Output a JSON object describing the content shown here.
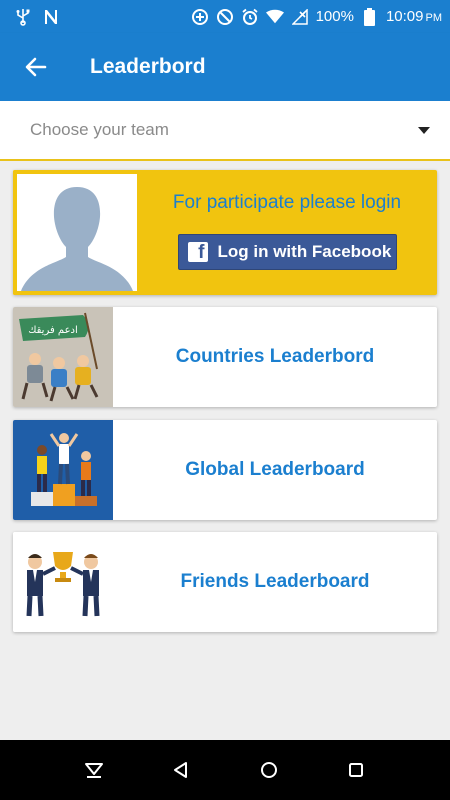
{
  "status_bar": {
    "battery_percent": "100%",
    "time": "10:09",
    "ampm": "PM",
    "icons": [
      "usb-icon",
      "n-notification-icon",
      "data-saver-icon",
      "do-not-disturb-icon",
      "alarm-icon",
      "wifi-icon",
      "no-signal-icon",
      "battery-icon"
    ]
  },
  "app_bar": {
    "title": "Leaderbord",
    "back_icon": "arrow-back-icon",
    "color": "#1b7fcf"
  },
  "team_select": {
    "placeholder": "Choose your team",
    "accent": "#e9c21a"
  },
  "login_card": {
    "prompt": "For participate please login",
    "facebook_button": "Log in with Facebook",
    "facebook_logo_letter": "f",
    "background": "#f1c40f"
  },
  "leaderboards": [
    {
      "label": "Countries Leaderbord",
      "banner_text": "ادعم فريقك",
      "thumbnail": "kids-with-flag-illustration"
    },
    {
      "label": "Global Leaderboard",
      "thumbnail": "podium-winners-illustration"
    },
    {
      "label": "Friends Leaderboard",
      "thumbnail": "businessmen-trophy-illustration"
    }
  ],
  "nav_bar": {
    "icons": [
      "keyboard-hide-icon",
      "back-triangle-icon",
      "home-circle-icon",
      "recents-square-icon"
    ]
  }
}
